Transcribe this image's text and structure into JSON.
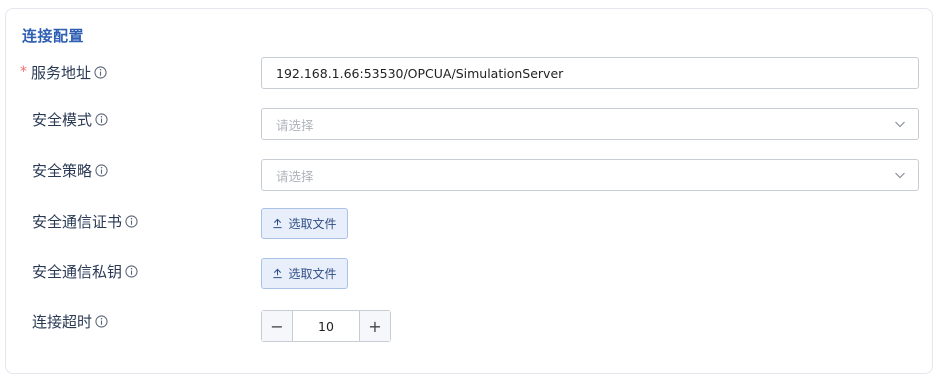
{
  "section": {
    "title": "连接配置"
  },
  "fields": {
    "server_address": {
      "required_mark": "*",
      "label": "服务地址",
      "value": "192.168.1.66:53530/OPCUA/SimulationServer"
    },
    "security_mode": {
      "label": "安全模式",
      "placeholder": "请选择"
    },
    "security_policy": {
      "label": "安全策略",
      "placeholder": "请选择"
    },
    "certificate": {
      "label": "安全通信证书",
      "button_label": "选取文件"
    },
    "private_key": {
      "label": "安全通信私钥",
      "button_label": "选取文件"
    },
    "timeout": {
      "label": "连接超时",
      "value": "10",
      "minus": "−",
      "plus": "+"
    }
  },
  "colors": {
    "accent": "#2f5fb3",
    "required": "#f56c6c",
    "upload_bg": "#e9effa",
    "border": "#c8ccd4"
  },
  "icons": {
    "info": "info-circle-icon",
    "select": "chevron-down-icon",
    "upload": "upload-icon"
  }
}
